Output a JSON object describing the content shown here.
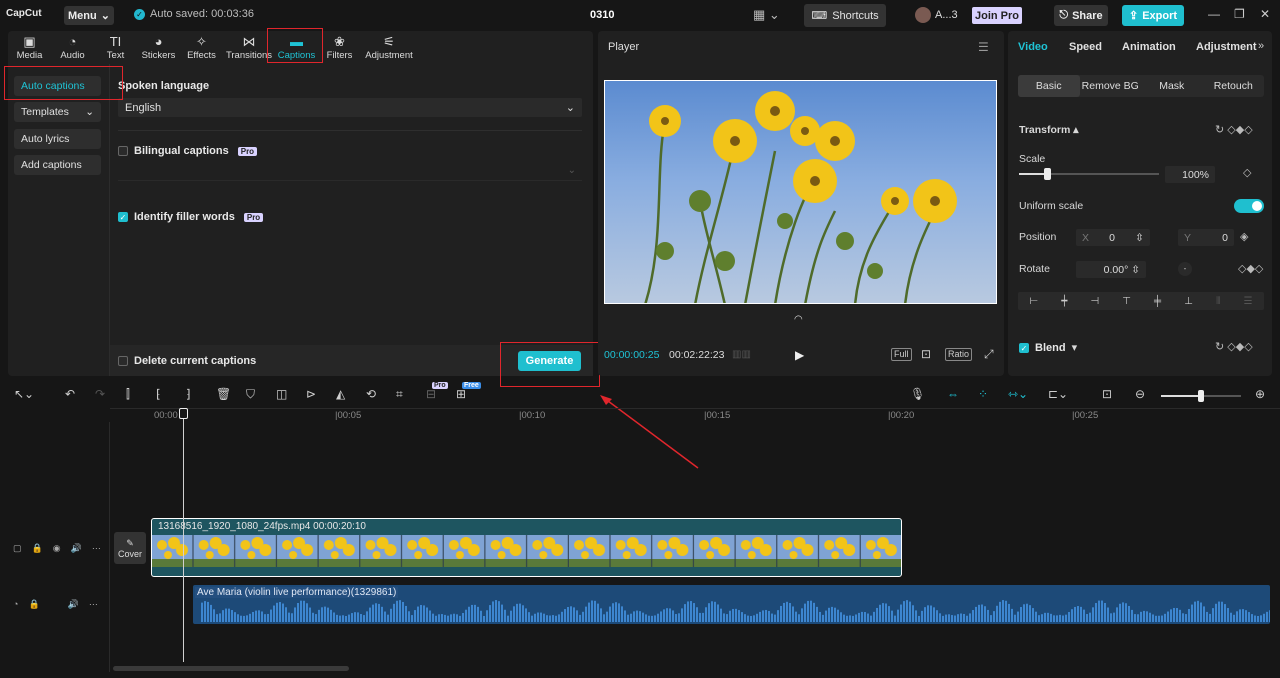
{
  "app": {
    "logo": "CapCut",
    "menu_label": "Menu",
    "autosave": "Auto saved: 00:03:36",
    "project_title": "0310",
    "shortcuts_label": "Shortcuts",
    "user_name": "A...3",
    "join_pro": "Join Pro",
    "share_label": "Share",
    "export_label": "Export"
  },
  "toolbar": {
    "tabs": [
      {
        "label": "Media",
        "icon": "media-icon",
        "glyph": "▣"
      },
      {
        "label": "Audio",
        "icon": "audio-icon",
        "glyph": "◔"
      },
      {
        "label": "Text",
        "icon": "text-icon",
        "glyph": "TI"
      },
      {
        "label": "Stickers",
        "icon": "sticker-icon",
        "glyph": "◕"
      },
      {
        "label": "Effects",
        "icon": "effects-icon",
        "glyph": "✧"
      },
      {
        "label": "Transitions",
        "icon": "transitions-icon",
        "glyph": "⋈"
      },
      {
        "label": "Captions",
        "icon": "captions-icon",
        "glyph": "▬"
      },
      {
        "label": "Filters",
        "icon": "filters-icon",
        "glyph": "❀"
      },
      {
        "label": "Adjustment",
        "icon": "adjustment-icon",
        "glyph": "⚟"
      }
    ],
    "active": "Captions"
  },
  "sidebar": {
    "items": [
      {
        "label": "Auto captions"
      },
      {
        "label": "Templates",
        "chevron": "⌄"
      },
      {
        "label": "Auto lyrics"
      },
      {
        "label": "Add captions"
      }
    ]
  },
  "captions": {
    "spoken_language_label": "Spoken language",
    "language_value": "English",
    "bilingual_label": "Bilingual captions",
    "filler_label": "Identify filler words",
    "pro_badge": "Pro",
    "delete_label": "Delete current captions",
    "generate_label": "Generate"
  },
  "player": {
    "title": "Player",
    "timecode": "00:00:00:25",
    "duration": "00:02:22:23",
    "full_label": "Full",
    "ratio_label": "Ratio"
  },
  "inspector": {
    "tabs": [
      "Video",
      "Speed",
      "Animation",
      "Adjustment"
    ],
    "subtabs": [
      "Basic",
      "Remove BG",
      "Mask",
      "Retouch"
    ],
    "transform_label": "Transform",
    "scale_label": "Scale",
    "scale_value": "100%",
    "scale_level": 0.2,
    "uniform_scale_label": "Uniform scale",
    "position_label": "Position",
    "pos_x_label": "X",
    "pos_x": "0",
    "pos_y_label": "Y",
    "pos_y": "0",
    "rotate_label": "Rotate",
    "rotate_value": "0.00°",
    "blend_label": "Blend"
  },
  "timeline": {
    "pro_tag": "Pro",
    "free_tag": "Free",
    "ruler": [
      "00:00",
      "|00:05",
      "|00:10",
      "|00:15",
      "|00:20",
      "|00:25"
    ],
    "cover_label": "Cover",
    "video_clip_label": "13168516_1920_1080_24fps.mp4   00:00:20:10",
    "audio_clip_label": "Ave Maria (violin live performance)(1329861)",
    "zoom_level": 0.5
  },
  "colors": {
    "accent": "#1fbfcf",
    "highlight_box": "#e0262c"
  }
}
